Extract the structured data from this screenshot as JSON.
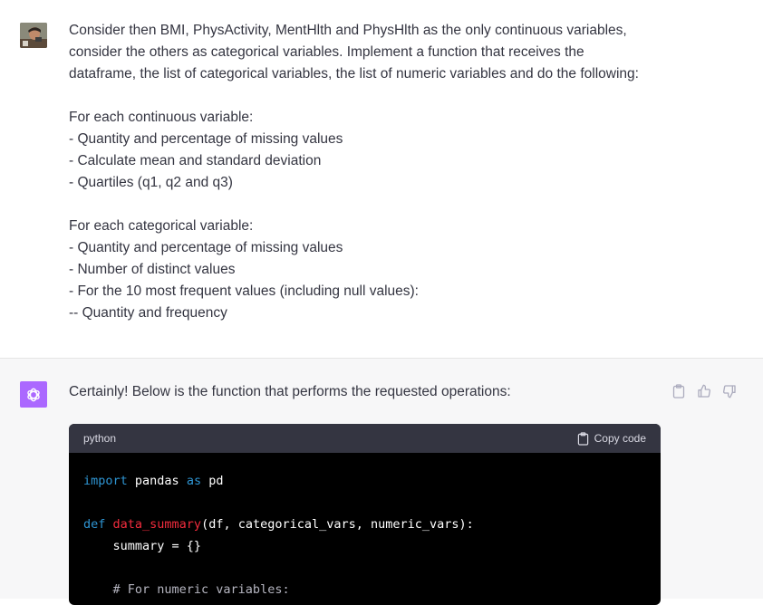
{
  "user": {
    "avatar": "user-photo-avatar",
    "lines": [
      "Consider then BMI, PhysActivity, MentHlth and PhysHlth as the only continuous variables,",
      "consider the others as categorical variables. Implement a function that receives the",
      "dataframe, the list of categorical variables, the list of numeric variables and do the following:",
      "",
      "For each continuous variable:",
      "- Quantity and percentage of missing values",
      "- Calculate mean and standard deviation",
      "- Quartiles (q1, q2 and q3)",
      "",
      "For each categorical variable:",
      "- Quantity and percentage of missing values",
      "- Number of distinct values",
      "- For the 10 most frequent values (including null values):",
      "-- Quantity and frequency"
    ]
  },
  "assistant": {
    "avatar": "openai-logo-icon",
    "avatar_color": "#ab68ff",
    "intro": "Certainly! Below is the function that performs the requested operations:",
    "code": {
      "language": "python",
      "copy_label": "Copy code",
      "line1": {
        "kw1": "import",
        "t1": " pandas ",
        "kw2": "as",
        "t2": " pd"
      },
      "line3": {
        "kw": "def",
        "sp": " ",
        "fn": "data_summary",
        "rest": "(df, categorical_vars, numeric_vars):"
      },
      "line4": "    summary = {}",
      "line6": "    # For numeric variables:"
    }
  },
  "colors": {
    "keyword": "#2e95d3",
    "function_name": "#f22c3d",
    "code_bg": "#000000",
    "code_header_bg": "#343541"
  }
}
